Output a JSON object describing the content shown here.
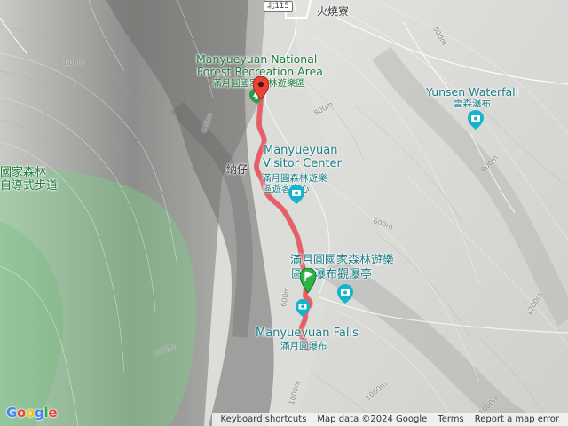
{
  "map": {
    "roads": {
      "route_shield": "北115",
      "village": "火燒寮"
    },
    "pois": {
      "recreation_area": {
        "name_en_1": "Manyueyuan National",
        "name_en_2": "Forest Recreation Area",
        "name_zh": "滿月圓國家森林遊樂區",
        "icon": "tree-icon"
      },
      "yunsen_waterfall": {
        "name_en": "Yunsen Waterfall",
        "name_zh": "雲森瀑布",
        "icon": "camera-icon"
      },
      "visitor_center": {
        "name_en_1": "Manyueyuan",
        "name_en_2": "Visitor Center",
        "name_zh_1": "滿月圓森林遊樂",
        "name_zh_2": "區遊客中心",
        "icon": "camera-icon"
      },
      "trail_left": {
        "name_zh_1": "國家森林",
        "name_zh_2": "自導式步道"
      },
      "nazai": {
        "name_zh": "納仔"
      },
      "fairy_falls": {
        "name_zh_1": "滿月圓國家森林遊樂",
        "name_zh_2": "區女瀑布觀瀑亭",
        "icon": "camera-icon"
      },
      "manyueyuan_falls": {
        "name_en": "Manyueyuan Falls",
        "name_zh": "滿月圓瀑布"
      }
    },
    "contours": [
      "800m",
      "600m",
      "600m",
      "800m",
      "600m",
      "1000m",
      "1200m",
      "600m",
      "1000m",
      "1000m",
      "1000m",
      "800m"
    ],
    "route": {
      "color": "#e8414a",
      "start_marker": "green-flag-marker",
      "end_marker": "red-pin-marker"
    }
  },
  "attribution": {
    "logo": "Google",
    "keyboard_shortcuts": "Keyboard shortcuts",
    "map_data": "Map data ©2024 Google",
    "terms": "Terms",
    "report": "Report a map error"
  }
}
